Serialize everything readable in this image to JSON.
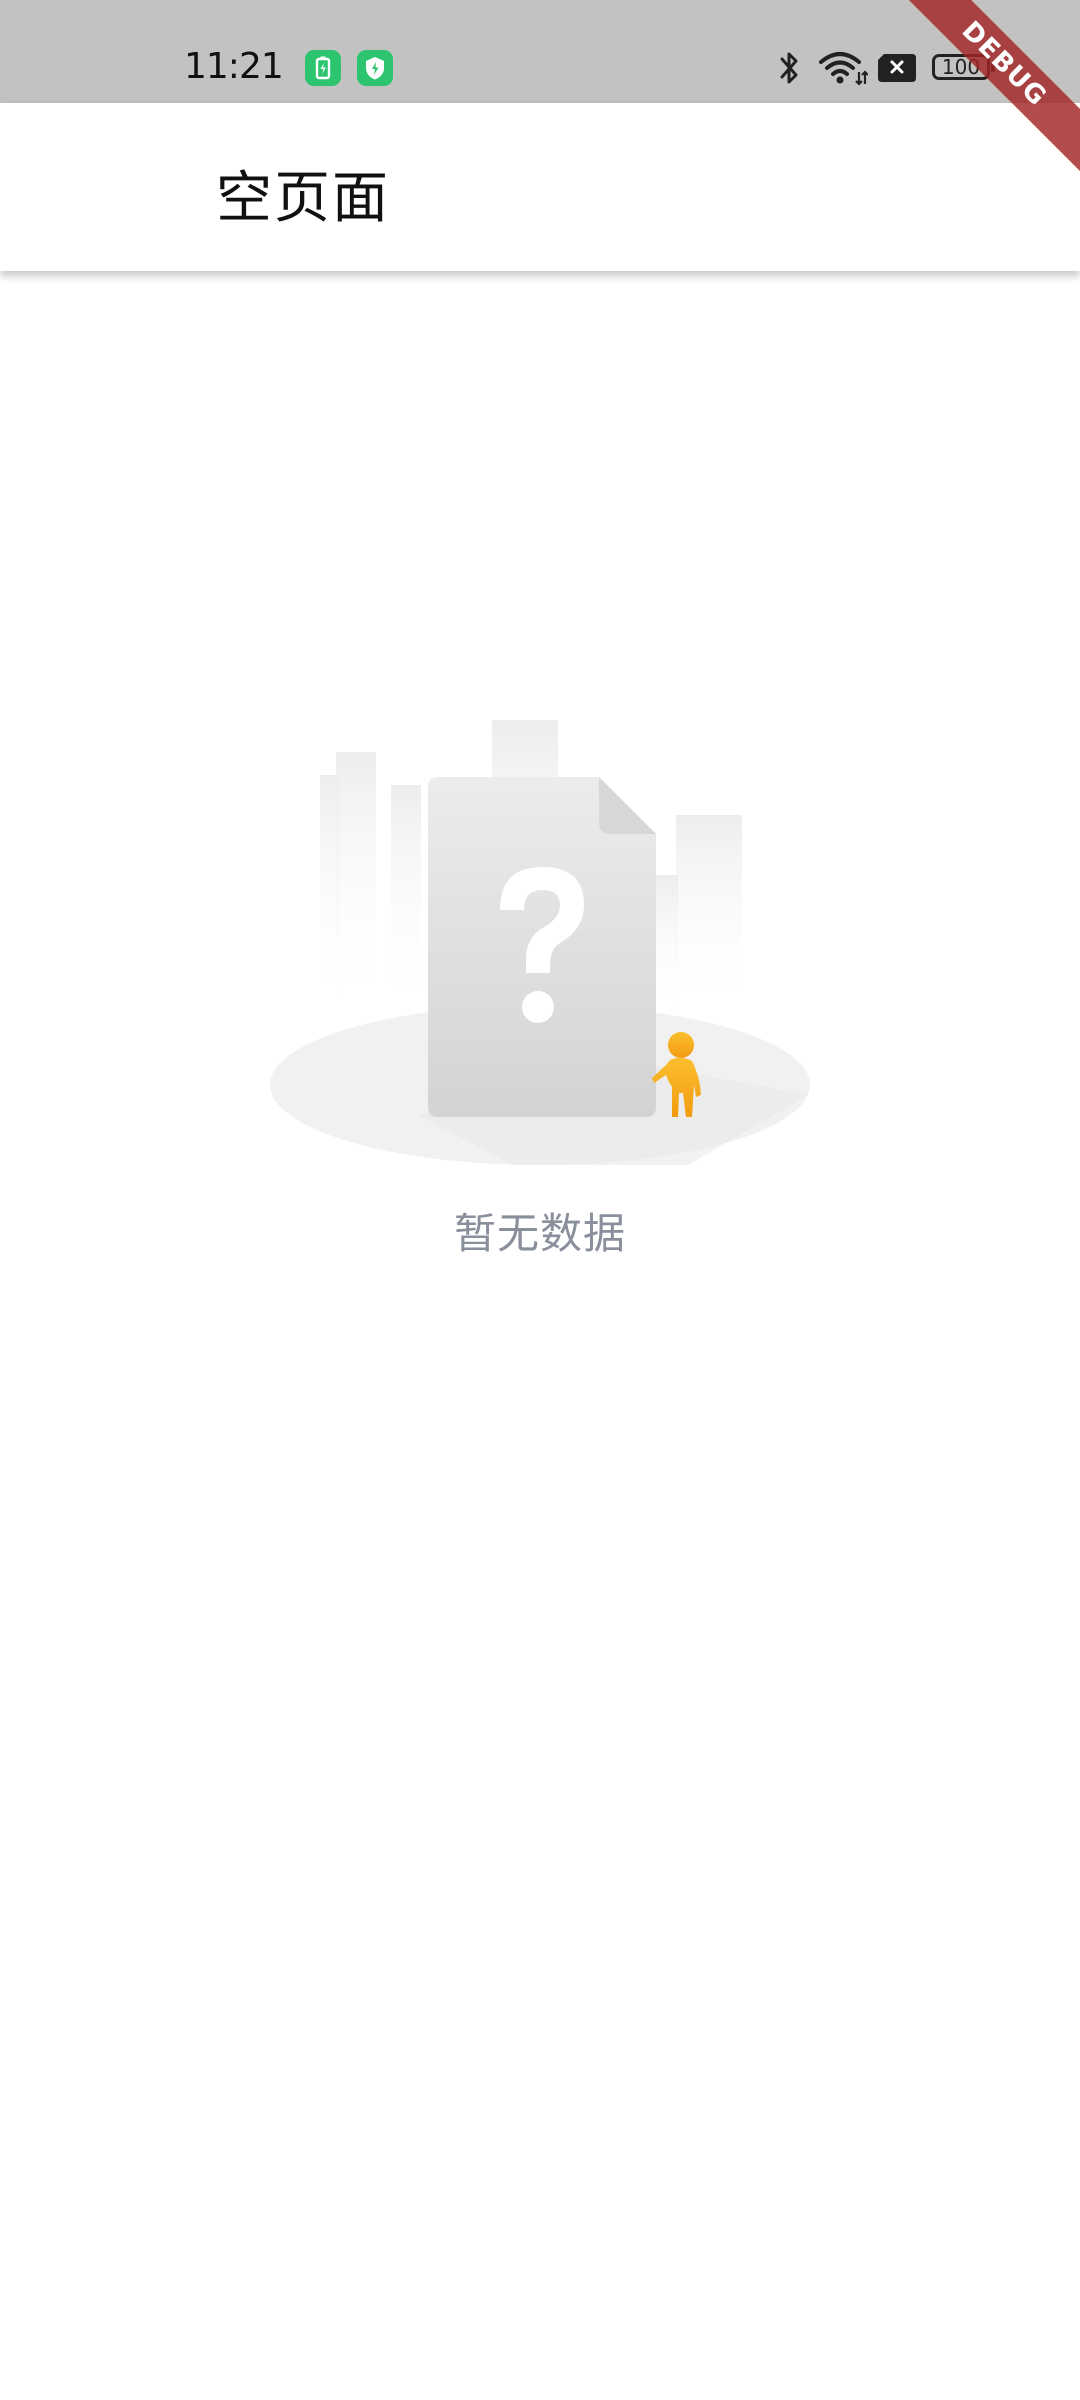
{
  "status_bar": {
    "time": "11:21",
    "battery_level": "100",
    "notification_icons": [
      "battery-saver-icon",
      "security-shield-icon"
    ],
    "system_icons": [
      "bluetooth-icon",
      "wifi-icon",
      "no-sim-icon",
      "battery-icon"
    ]
  },
  "debug_banner": {
    "label": "DEBUG",
    "color": "#a22626"
  },
  "app_bar": {
    "title": "空页面"
  },
  "empty_state": {
    "illustration": "empty-document-question-icon",
    "message": "暂无数据",
    "text_color": "#8a8f9c",
    "figure_color": "#f5a31a"
  }
}
